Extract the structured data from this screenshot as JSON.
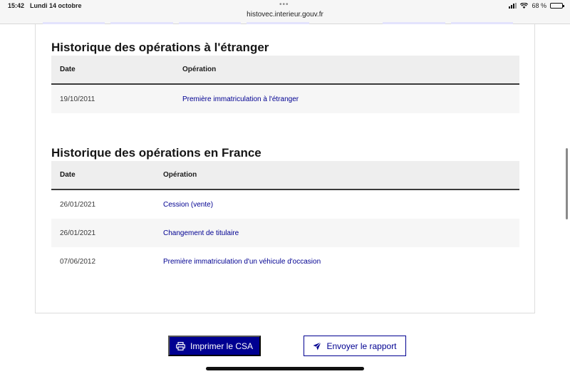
{
  "status_bar": {
    "time": "15:42",
    "date": "Lundi 14 octobre",
    "dots": "•••",
    "url": "histovec.interieur.gouv.fr",
    "battery": "68 %",
    "battery_level": 0.68
  },
  "foreign_section": {
    "title": "Historique des opérations à l'étranger",
    "headers": {
      "date": "Date",
      "operation": "Opération"
    },
    "rows": [
      {
        "date": "19/10/2011",
        "operation": "Première immatriculation à l'étranger"
      }
    ]
  },
  "france_section": {
    "title": "Historique des opérations en France",
    "headers": {
      "date": "Date",
      "operation": "Opération"
    },
    "rows": [
      {
        "date": "26/01/2021",
        "operation": "Cession (vente)"
      },
      {
        "date": "26/01/2021",
        "operation": "Changement de titulaire"
      },
      {
        "date": "07/06/2012",
        "operation": "Première immatriculation d'un véhicule d'occasion"
      }
    ]
  },
  "actions": {
    "print_label": "Imprimer le CSA",
    "send_label": "Envoyer le rapport"
  },
  "colors": {
    "primary": "#000091",
    "header_bg": "#eeeeee",
    "row_alt_bg": "#f6f6f6"
  },
  "icons": {
    "print": "printer-icon",
    "send": "send-icon"
  }
}
